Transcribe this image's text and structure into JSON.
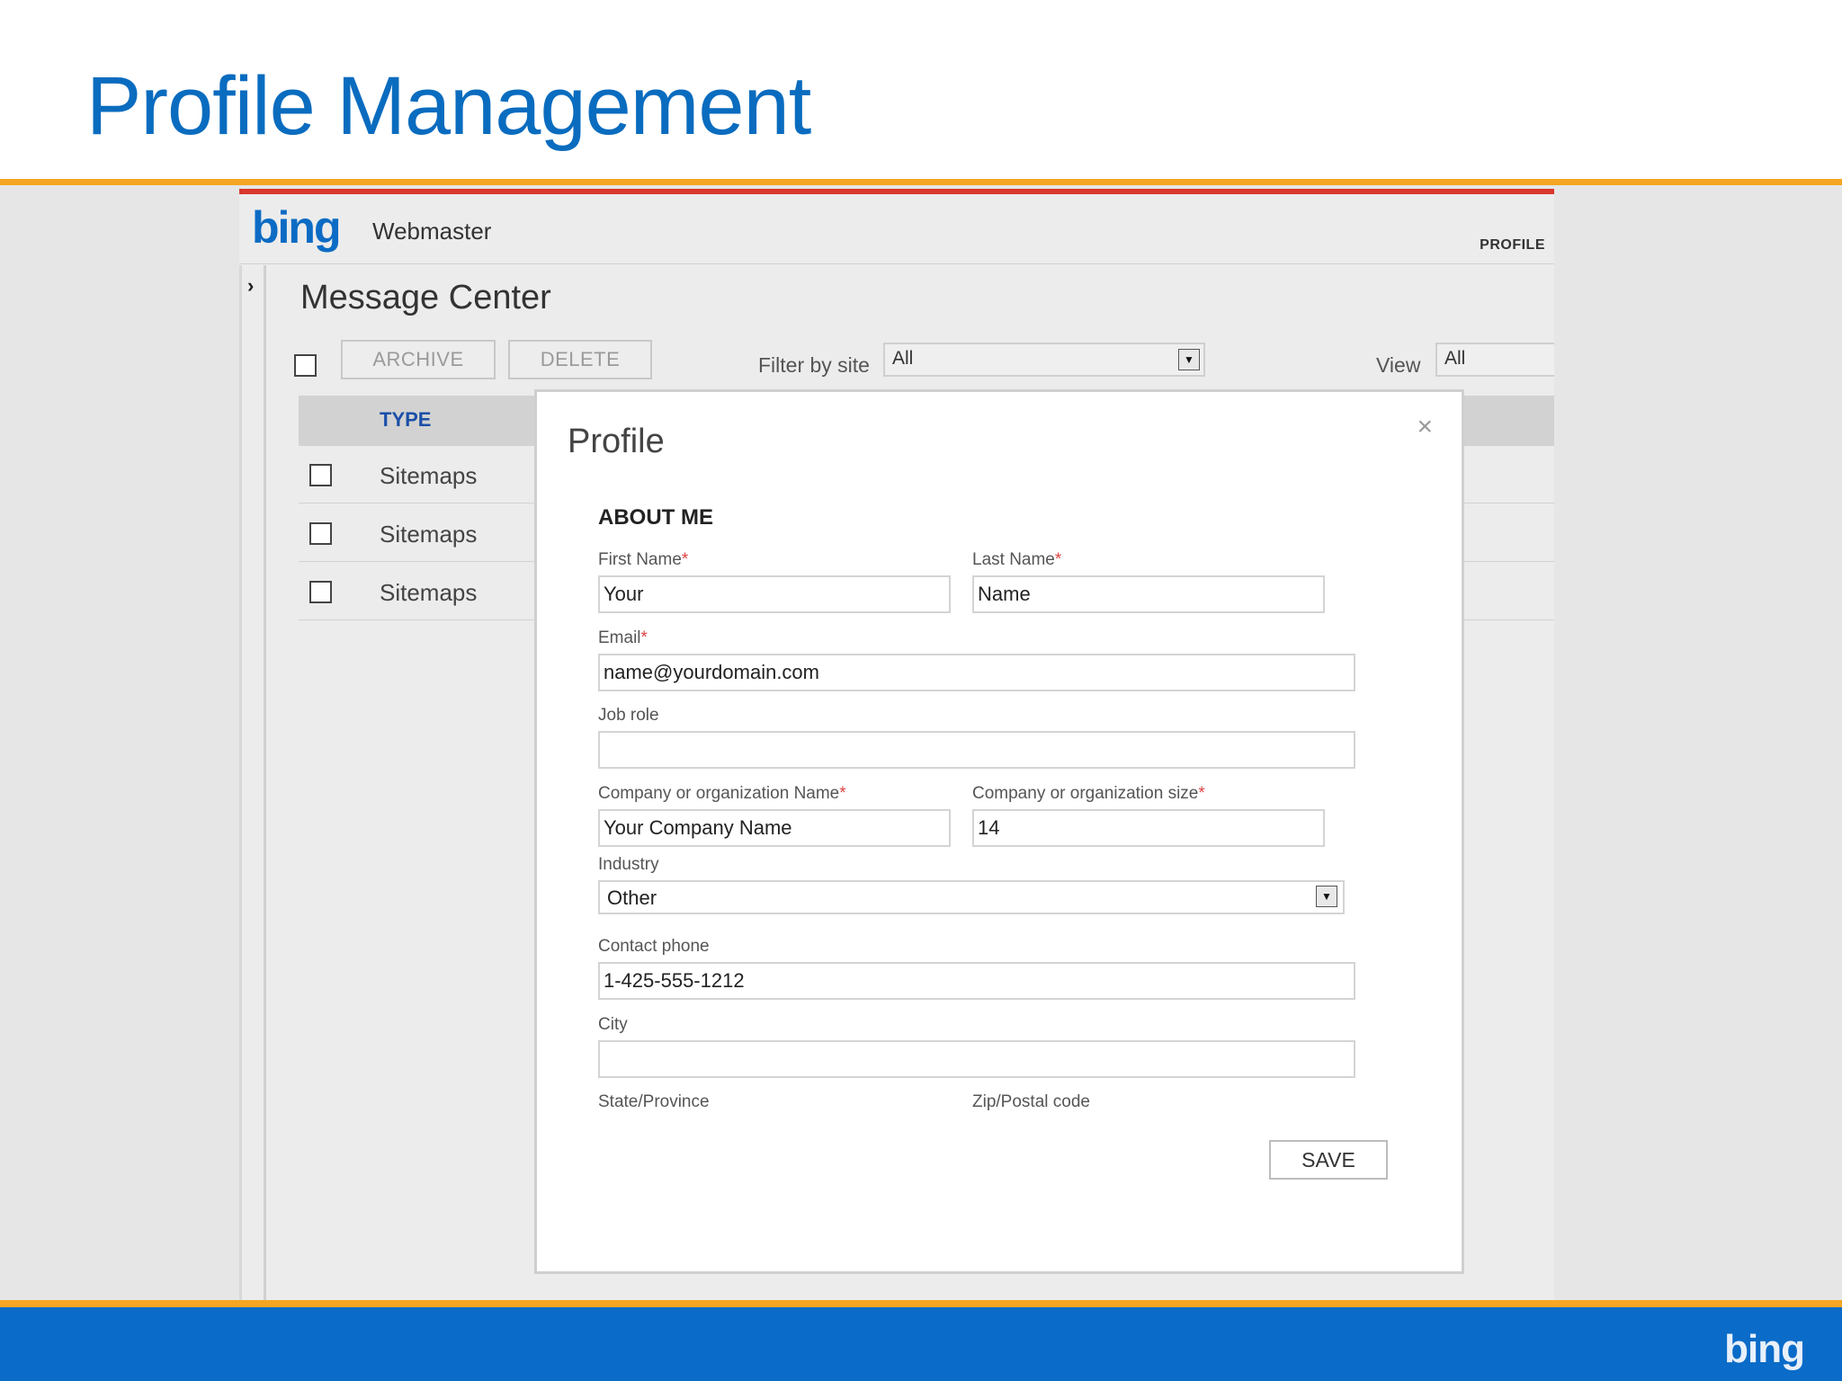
{
  "slide": {
    "title": "Profile Management",
    "footer_logo": "bing"
  },
  "app": {
    "logo": "bing",
    "name": "Webmaster",
    "profile_link": "PROFILE",
    "page_title": "Message Center",
    "toolbar": {
      "archive_label": "ARCHIVE",
      "delete_label": "DELETE",
      "filter_label": "Filter by site",
      "filter_value": "All",
      "view_label": "View",
      "view_value": "All"
    },
    "table": {
      "column_type": "TYPE",
      "rows": [
        {
          "type": "Sitemaps"
        },
        {
          "type": "Sitemaps"
        },
        {
          "type": "Sitemaps"
        }
      ]
    }
  },
  "modal": {
    "title": "Profile",
    "close_glyph": "×",
    "section": "ABOUT ME",
    "required_mark": "*",
    "fields": {
      "first_name": {
        "label": "First Name",
        "value": "Your"
      },
      "last_name": {
        "label": "Last Name",
        "value": "Name"
      },
      "email": {
        "label": "Email",
        "value": "name@yourdomain.com"
      },
      "job_role": {
        "label": "Job role",
        "value": ""
      },
      "company_name": {
        "label": "Company or organization Name",
        "value": "Your Company Name"
      },
      "company_size": {
        "label": "Company or organization size",
        "value": "14"
      },
      "industry": {
        "label": "Industry",
        "value": "Other"
      },
      "contact_phone": {
        "label": "Contact phone",
        "value": "1-425-555-1212"
      },
      "city": {
        "label": "City",
        "value": ""
      },
      "state": {
        "label": "State/Province",
        "value": ""
      },
      "zip": {
        "label": "Zip/Postal code",
        "value": ""
      }
    },
    "save_label": "SAVE"
  },
  "colors": {
    "title_blue": "#0a6cbf",
    "accent_orange": "#f5a623",
    "footer_blue": "#0a6bc8",
    "app_red": "#d9382c",
    "required_red": "#dd4444",
    "type_header_blue": "#1b4fa8"
  },
  "icons": {
    "chevron": "chevron-right-icon",
    "close": "close-icon",
    "dropdown": "dropdown-arrow-icon",
    "scroll_up": "scroll-up-icon",
    "scroll_down": "scroll-down-icon"
  }
}
